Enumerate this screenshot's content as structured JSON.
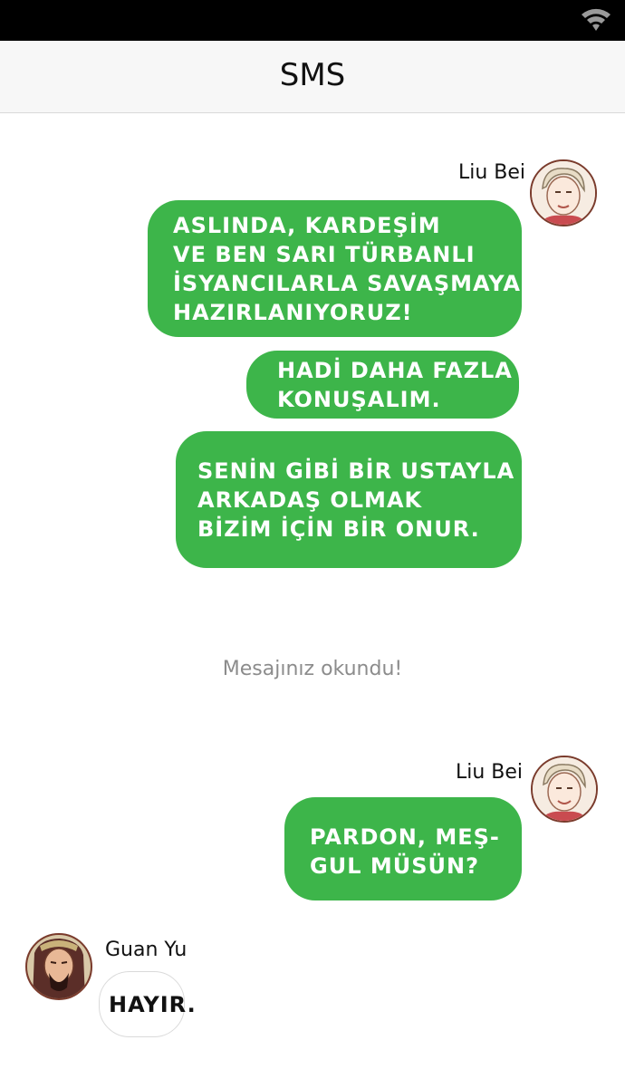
{
  "app": {
    "title": "SMS"
  },
  "messages": [
    {
      "sender": "Liu Bei",
      "text": "ASLINDA, KARDEŞİM\nVE BEN SARI TÜRBANLI\nİSYANCILARLA SAVAŞMAYA\nHAZIRLANIYORUZ!"
    },
    {
      "text": "HADİ DAHA FAZLA\nKONUŞALIM."
    },
    {
      "text": "SENİN GİBİ BİR USTAYLA\nARKADAŞ OLMAK\nBİZİM İÇİN BİR ONUR."
    },
    {
      "sender": "Liu Bei",
      "text": "PARDON, MEŞ-\nGUL MÜSÜN?"
    },
    {
      "sender": "Guan Yu",
      "text": "HAYIR."
    }
  ],
  "read_receipt": "Mesajınız okundu!",
  "colors": {
    "bubble_green": "#3db54a",
    "header_bg": "#f7f7f7",
    "status_bar": "#000000"
  },
  "icons": {
    "status": "wifi-icon"
  }
}
